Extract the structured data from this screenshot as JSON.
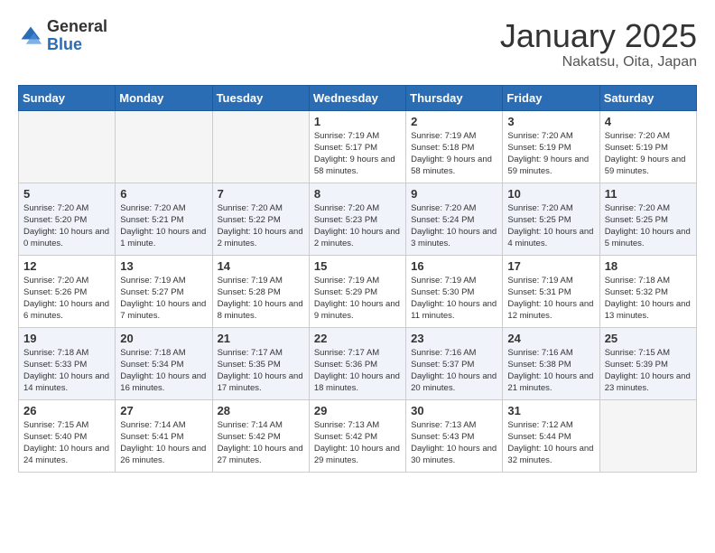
{
  "header": {
    "logo_general": "General",
    "logo_blue": "Blue",
    "month_title": "January 2025",
    "location": "Nakatsu, Oita, Japan"
  },
  "weekdays": [
    "Sunday",
    "Monday",
    "Tuesday",
    "Wednesday",
    "Thursday",
    "Friday",
    "Saturday"
  ],
  "weeks": [
    [
      {
        "day": "",
        "sunrise": "",
        "sunset": "",
        "daylight": ""
      },
      {
        "day": "",
        "sunrise": "",
        "sunset": "",
        "daylight": ""
      },
      {
        "day": "",
        "sunrise": "",
        "sunset": "",
        "daylight": ""
      },
      {
        "day": "1",
        "sunrise": "Sunrise: 7:19 AM",
        "sunset": "Sunset: 5:17 PM",
        "daylight": "Daylight: 9 hours and 58 minutes."
      },
      {
        "day": "2",
        "sunrise": "Sunrise: 7:19 AM",
        "sunset": "Sunset: 5:18 PM",
        "daylight": "Daylight: 9 hours and 58 minutes."
      },
      {
        "day": "3",
        "sunrise": "Sunrise: 7:20 AM",
        "sunset": "Sunset: 5:19 PM",
        "daylight": "Daylight: 9 hours and 59 minutes."
      },
      {
        "day": "4",
        "sunrise": "Sunrise: 7:20 AM",
        "sunset": "Sunset: 5:19 PM",
        "daylight": "Daylight: 9 hours and 59 minutes."
      }
    ],
    [
      {
        "day": "5",
        "sunrise": "Sunrise: 7:20 AM",
        "sunset": "Sunset: 5:20 PM",
        "daylight": "Daylight: 10 hours and 0 minutes."
      },
      {
        "day": "6",
        "sunrise": "Sunrise: 7:20 AM",
        "sunset": "Sunset: 5:21 PM",
        "daylight": "Daylight: 10 hours and 1 minute."
      },
      {
        "day": "7",
        "sunrise": "Sunrise: 7:20 AM",
        "sunset": "Sunset: 5:22 PM",
        "daylight": "Daylight: 10 hours and 2 minutes."
      },
      {
        "day": "8",
        "sunrise": "Sunrise: 7:20 AM",
        "sunset": "Sunset: 5:23 PM",
        "daylight": "Daylight: 10 hours and 2 minutes."
      },
      {
        "day": "9",
        "sunrise": "Sunrise: 7:20 AM",
        "sunset": "Sunset: 5:24 PM",
        "daylight": "Daylight: 10 hours and 3 minutes."
      },
      {
        "day": "10",
        "sunrise": "Sunrise: 7:20 AM",
        "sunset": "Sunset: 5:25 PM",
        "daylight": "Daylight: 10 hours and 4 minutes."
      },
      {
        "day": "11",
        "sunrise": "Sunrise: 7:20 AM",
        "sunset": "Sunset: 5:25 PM",
        "daylight": "Daylight: 10 hours and 5 minutes."
      }
    ],
    [
      {
        "day": "12",
        "sunrise": "Sunrise: 7:20 AM",
        "sunset": "Sunset: 5:26 PM",
        "daylight": "Daylight: 10 hours and 6 minutes."
      },
      {
        "day": "13",
        "sunrise": "Sunrise: 7:19 AM",
        "sunset": "Sunset: 5:27 PM",
        "daylight": "Daylight: 10 hours and 7 minutes."
      },
      {
        "day": "14",
        "sunrise": "Sunrise: 7:19 AM",
        "sunset": "Sunset: 5:28 PM",
        "daylight": "Daylight: 10 hours and 8 minutes."
      },
      {
        "day": "15",
        "sunrise": "Sunrise: 7:19 AM",
        "sunset": "Sunset: 5:29 PM",
        "daylight": "Daylight: 10 hours and 9 minutes."
      },
      {
        "day": "16",
        "sunrise": "Sunrise: 7:19 AM",
        "sunset": "Sunset: 5:30 PM",
        "daylight": "Daylight: 10 hours and 11 minutes."
      },
      {
        "day": "17",
        "sunrise": "Sunrise: 7:19 AM",
        "sunset": "Sunset: 5:31 PM",
        "daylight": "Daylight: 10 hours and 12 minutes."
      },
      {
        "day": "18",
        "sunrise": "Sunrise: 7:18 AM",
        "sunset": "Sunset: 5:32 PM",
        "daylight": "Daylight: 10 hours and 13 minutes."
      }
    ],
    [
      {
        "day": "19",
        "sunrise": "Sunrise: 7:18 AM",
        "sunset": "Sunset: 5:33 PM",
        "daylight": "Daylight: 10 hours and 14 minutes."
      },
      {
        "day": "20",
        "sunrise": "Sunrise: 7:18 AM",
        "sunset": "Sunset: 5:34 PM",
        "daylight": "Daylight: 10 hours and 16 minutes."
      },
      {
        "day": "21",
        "sunrise": "Sunrise: 7:17 AM",
        "sunset": "Sunset: 5:35 PM",
        "daylight": "Daylight: 10 hours and 17 minutes."
      },
      {
        "day": "22",
        "sunrise": "Sunrise: 7:17 AM",
        "sunset": "Sunset: 5:36 PM",
        "daylight": "Daylight: 10 hours and 18 minutes."
      },
      {
        "day": "23",
        "sunrise": "Sunrise: 7:16 AM",
        "sunset": "Sunset: 5:37 PM",
        "daylight": "Daylight: 10 hours and 20 minutes."
      },
      {
        "day": "24",
        "sunrise": "Sunrise: 7:16 AM",
        "sunset": "Sunset: 5:38 PM",
        "daylight": "Daylight: 10 hours and 21 minutes."
      },
      {
        "day": "25",
        "sunrise": "Sunrise: 7:15 AM",
        "sunset": "Sunset: 5:39 PM",
        "daylight": "Daylight: 10 hours and 23 minutes."
      }
    ],
    [
      {
        "day": "26",
        "sunrise": "Sunrise: 7:15 AM",
        "sunset": "Sunset: 5:40 PM",
        "daylight": "Daylight: 10 hours and 24 minutes."
      },
      {
        "day": "27",
        "sunrise": "Sunrise: 7:14 AM",
        "sunset": "Sunset: 5:41 PM",
        "daylight": "Daylight: 10 hours and 26 minutes."
      },
      {
        "day": "28",
        "sunrise": "Sunrise: 7:14 AM",
        "sunset": "Sunset: 5:42 PM",
        "daylight": "Daylight: 10 hours and 27 minutes."
      },
      {
        "day": "29",
        "sunrise": "Sunrise: 7:13 AM",
        "sunset": "Sunset: 5:42 PM",
        "daylight": "Daylight: 10 hours and 29 minutes."
      },
      {
        "day": "30",
        "sunrise": "Sunrise: 7:13 AM",
        "sunset": "Sunset: 5:43 PM",
        "daylight": "Daylight: 10 hours and 30 minutes."
      },
      {
        "day": "31",
        "sunrise": "Sunrise: 7:12 AM",
        "sunset": "Sunset: 5:44 PM",
        "daylight": "Daylight: 10 hours and 32 minutes."
      },
      {
        "day": "",
        "sunrise": "",
        "sunset": "",
        "daylight": ""
      }
    ]
  ]
}
